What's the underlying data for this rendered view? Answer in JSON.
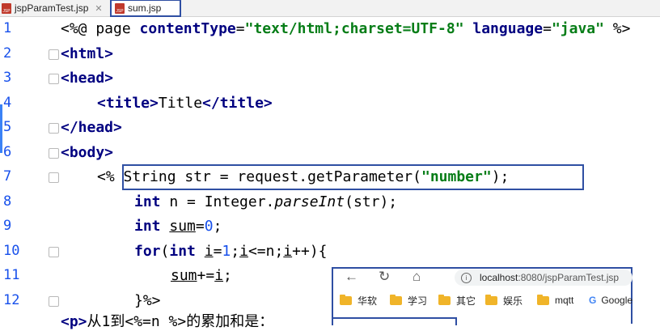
{
  "tabs": [
    {
      "label": "jspParamTest.jsp",
      "icon": "jsp-file-icon"
    },
    {
      "label": "sum.jsp",
      "icon": "jsp-file-icon"
    }
  ],
  "line_numbers": [
    "1",
    "2",
    "3",
    "4",
    "5",
    "6",
    "7",
    "8",
    "9",
    "10",
    "11",
    "12"
  ],
  "code": {
    "l1_a": "<%@ page ",
    "l1_b": "contentType",
    "l1_c": "=",
    "l1_d": "\"text/html;charset=UTF-8\"",
    "l1_e": " language",
    "l1_f": "=",
    "l1_g": "\"java\"",
    "l1_h": " %>",
    "l2": "<html>",
    "l3": "<head>",
    "l4_a": "<title>",
    "l4_b": "Title",
    "l4_c": "</title>",
    "l5": "</head>",
    "l6": "<body>",
    "l7_a": "<%",
    "l7_b": " String str = request.getParameter(",
    "l7_c": "\"number\"",
    "l7_d": ");",
    "l8_a": "int",
    "l8_b": " n = Integer.",
    "l8_c": "parseInt",
    "l8_d": "(str);",
    "l9_a": "int",
    "l9_b": "sum",
    "l9_c": "=",
    "l9_d": "0",
    "l9_e": ";",
    "l10_a": "for",
    "l10_b": "(",
    "l10_c": "int",
    "l10_d": "i",
    "l10_e": "=",
    "l10_f": "1",
    "l10_g": ";",
    "l10_h": "i",
    "l10_i": "<=n;",
    "l10_j": "i",
    "l10_k": "++){",
    "l11_a": "sum",
    "l11_b": "+=",
    "l11_c": "i",
    "l11_d": ";",
    "l12": "}%>",
    "l13_a": "<p>",
    "l13_b": "从1到",
    "l13_c": "<%=n %>",
    "l13_d": "的累加和是："
  },
  "browser": {
    "back": "←",
    "reload": "↻",
    "home": "⌂",
    "url_host": "localhost",
    "url_rest": ":8080/jspParamTest.jsp",
    "bookmarks": [
      "华软",
      "学习",
      "其它",
      "娱乐",
      "mqtt",
      "Google"
    ]
  },
  "colors": {
    "keyword": "#000080",
    "string": "#067d17",
    "number": "#1750eb",
    "highlight_border": "#2f4fa3"
  }
}
